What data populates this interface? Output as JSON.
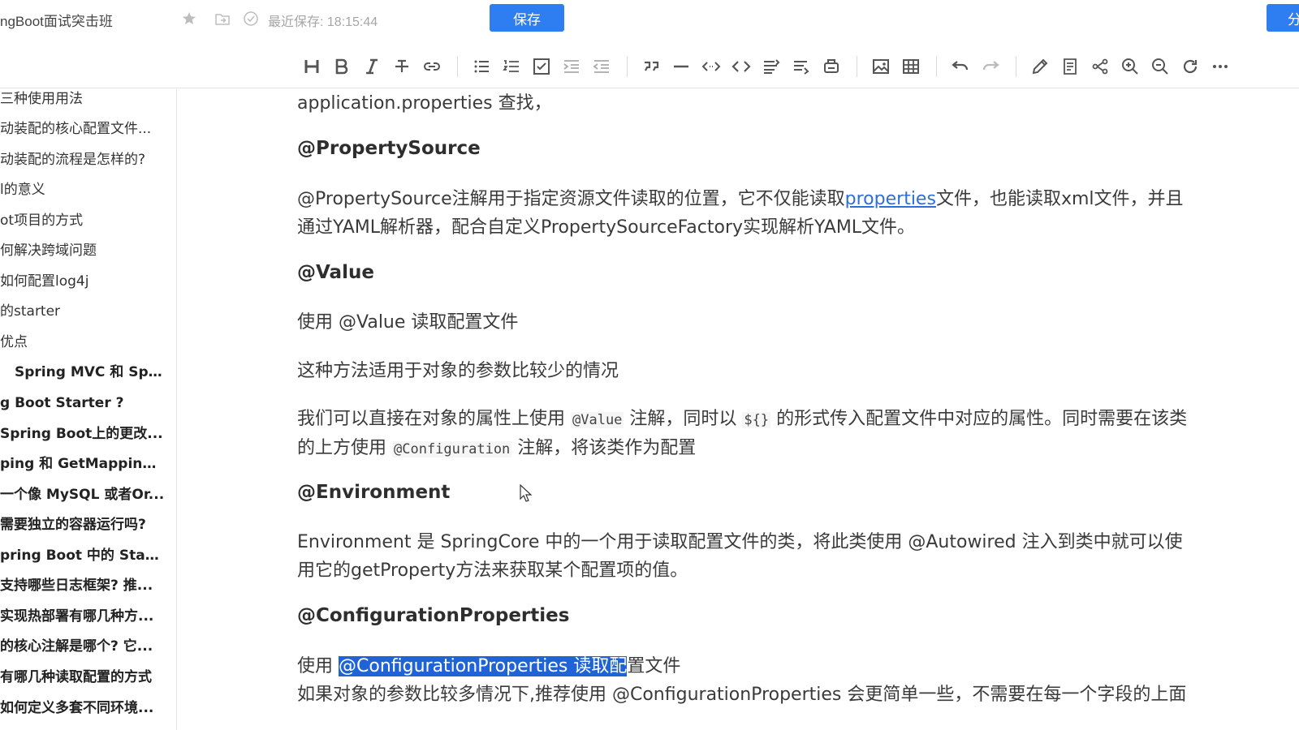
{
  "header": {
    "title": "ngBoot面试突击班",
    "save_status": "最近保存: 18:15:44",
    "save_label": "保存",
    "share_label": "分"
  },
  "toolbar": {
    "buttons": [
      "heading",
      "bold",
      "italic",
      "strikethrough",
      "link",
      "unordered-list",
      "ordered-list",
      "checklist",
      "indent",
      "outdent",
      "quote",
      "horizontal-rule",
      "inline-code",
      "code-block",
      "table-of-contents",
      "align",
      "export",
      "image",
      "table",
      "undo",
      "redo",
      "edit",
      "preview",
      "mind-map",
      "zoom-in",
      "zoom-out",
      "refresh",
      "more"
    ]
  },
  "sidebar": {
    "items": [
      {
        "label": "三种使用用法",
        "bold": false
      },
      {
        "label": "动装配的核心配置文件...",
        "bold": false
      },
      {
        "label": "动装配的流程是怎样的?",
        "bold": false
      },
      {
        "label": "l的意义",
        "bold": false
      },
      {
        "label": "ot项目的方式",
        "bold": false
      },
      {
        "label": "何解决跨域问题",
        "bold": false
      },
      {
        "label": "如何配置log4j",
        "bold": false
      },
      {
        "label": "的starter",
        "bold": false
      },
      {
        "label": "优点",
        "bold": false
      },
      {
        "label": "Spring MVC 和 Spr...",
        "bold": true
      },
      {
        "label": "g Boot Starter ?",
        "bold": true
      },
      {
        "label": "Spring Boot上的更改...",
        "bold": true
      },
      {
        "label": "ping 和 GetMapping...",
        "bold": true
      },
      {
        "label": "一个像 MySQL 或者Or...",
        "bold": true
      },
      {
        "label": "需要独立的容器运行吗?",
        "bold": true
      },
      {
        "label": "pring Boot 中的 Start...",
        "bold": true
      },
      {
        "label": "支持哪些日志框架? 推...",
        "bold": true
      },
      {
        "label": "实现热部署有哪几种方...",
        "bold": true
      },
      {
        "label": "的核心注解是哪个? 它...",
        "bold": true
      },
      {
        "label": "有哪几种读取配置的方式",
        "bold": true
      },
      {
        "label": "如何定义多套不同环境...",
        "bold": true
      }
    ]
  },
  "content": {
    "line1": "application.properties 查找，",
    "h_property_source": "@PropertySource",
    "ps_text_a": "@PropertySource注解用于指定资源文件读取的位置，它不仅能读取",
    "ps_link": "properties",
    "ps_text_b": "文件，也能读取xml文件，并且",
    "ps_text_c": "通过YAML解析器，配合自定义PropertySourceFactory实现解析YAML文件。",
    "h_value": "@Value",
    "value_1": "使用 @Value 读取配置文件",
    "value_2": "这种方法适用于对象的参数比较少的情况",
    "value_3a": "我们可以直接在对象的属性上使用 ",
    "value_3_code1": "@Value",
    "value_3b": " 注解，同时以 ",
    "value_3_code2": "${}",
    "value_3c": " 的形式传入配置文件中对应的属性。同时需要在该类",
    "value_4a": "的上方使用 ",
    "value_4_code": "@Configuration",
    "value_4b": " 注解，将该类作为配置",
    "h_environment": "@Environment",
    "env_1": "Environment 是 SpringCore 中的一个用于读取配置文件的类，将此类使用 @Autowired 注入到类中就可以使",
    "env_2": "用它的getProperty方法来获取某个配置项的值。",
    "h_config_props": "@ConfigurationProperties",
    "cp_1a": "使用 ",
    "cp_1_selected": "@ConfigurationProperties 读取配",
    "cp_1b": "置文件",
    "cp_2": "如果对象的参数比较多情况下,推荐使用 @ConfigurationProperties 会更简单一些，不需要在每一个字段的上面"
  },
  "colors": {
    "primary": "#2e7ef2",
    "selection": "#1f63d6",
    "link": "#2e6fd6"
  }
}
